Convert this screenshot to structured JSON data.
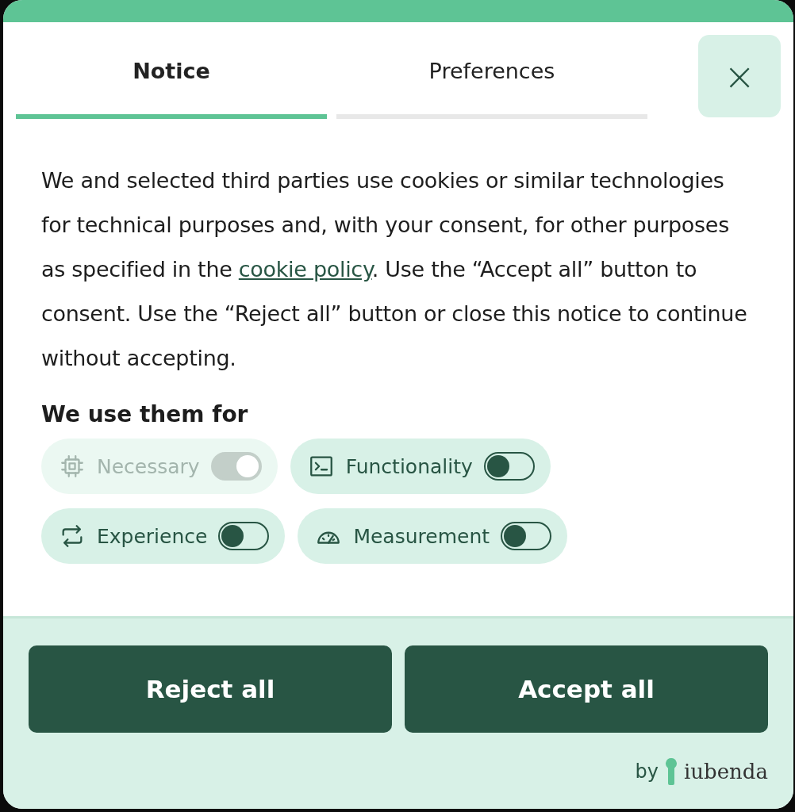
{
  "tabs": [
    {
      "label": "Notice",
      "selected": true
    },
    {
      "label": "Preferences",
      "selected": false
    }
  ],
  "close_button": "×",
  "notice": {
    "text_before": "We and selected third parties use cookies or similar technologies for technical purposes and, with your consent, for other purposes as specified in the ",
    "link": "cookie policy",
    "text_after": ". Use the “Accept all” button to consent. Use the “Reject all” button or close this notice to continue without accepting."
  },
  "purposes_heading": "We use them for",
  "purposes": [
    {
      "label": "Necessary",
      "on": true,
      "disabled": true
    },
    {
      "label": "Functionality",
      "on": false,
      "disabled": false
    },
    {
      "label": "Experience",
      "on": false,
      "disabled": false
    },
    {
      "label": "Measurement",
      "on": false,
      "disabled": false
    }
  ],
  "buttons": [
    "Reject all",
    "Accept all"
  ],
  "branding": {
    "prefix": "by",
    "name": "iubenda"
  }
}
